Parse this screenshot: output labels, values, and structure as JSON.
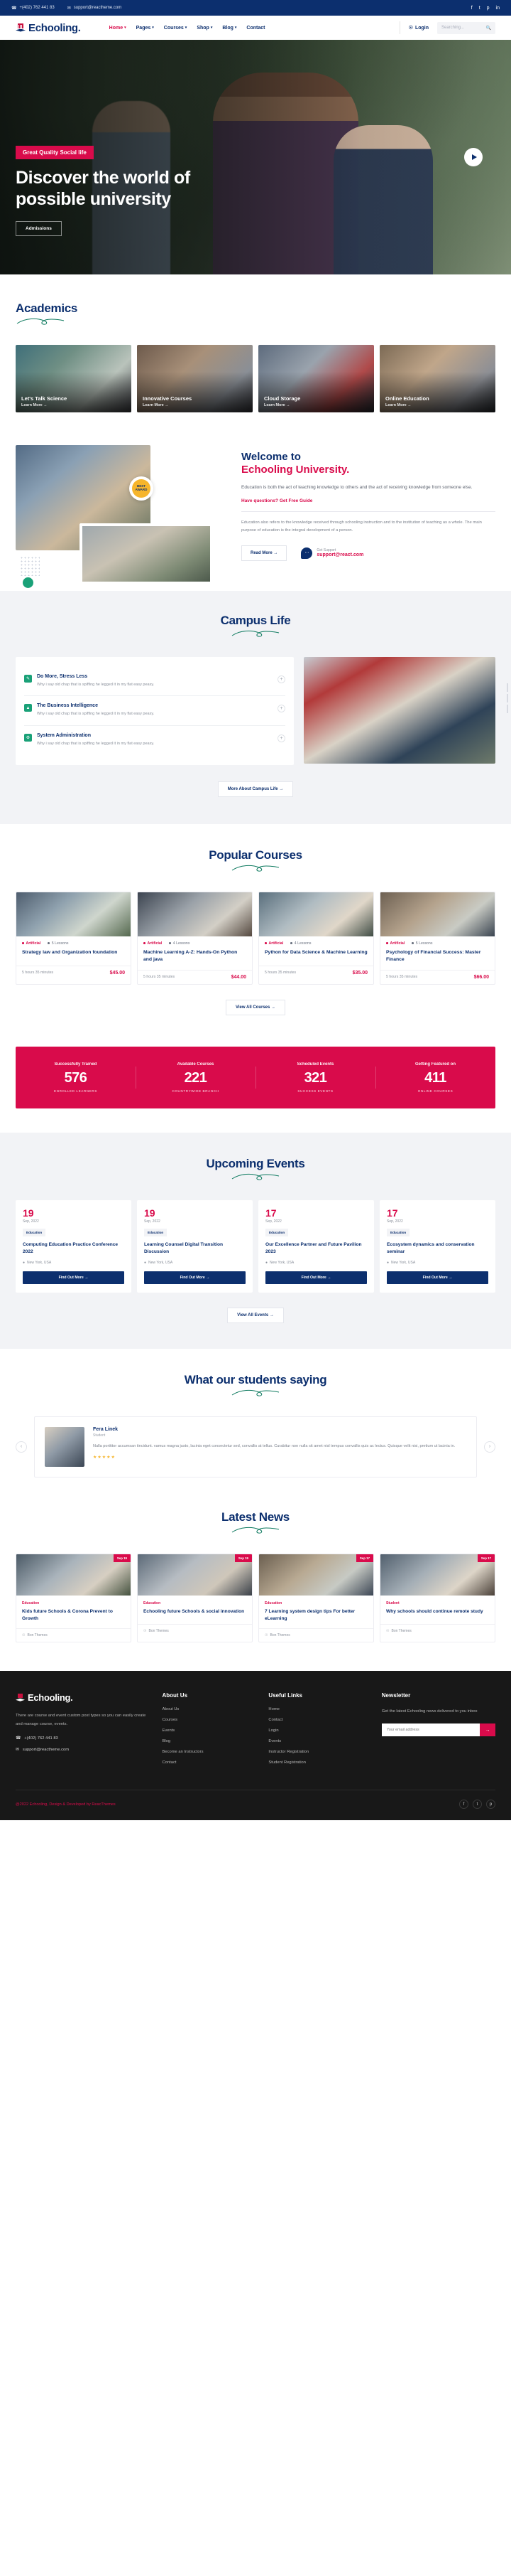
{
  "topbar": {
    "phone": "+(402) 762 441 83",
    "email": "support@reactheme.com",
    "phone_icon": "phone-icon",
    "email_icon": "envelope-icon",
    "socials": [
      "f",
      "t",
      "p",
      "in"
    ]
  },
  "header": {
    "logo_text": "Echooling.",
    "nav": [
      {
        "label": "Home",
        "caret": "▾",
        "active": true
      },
      {
        "label": "Pages",
        "caret": "▾",
        "active": false
      },
      {
        "label": "Courses",
        "caret": "▾",
        "active": false
      },
      {
        "label": "Shop",
        "caret": "▾",
        "active": false
      },
      {
        "label": "Blog",
        "caret": "▾",
        "active": false
      },
      {
        "label": "Contact",
        "caret": "",
        "active": false
      }
    ],
    "login_label": "Login",
    "search_placeholder": "Searching..."
  },
  "hero": {
    "badge": "Great Quality Social life",
    "title_line1": "Discover the world of",
    "title_line2": "possible university",
    "button": "Admissions",
    "play_label": "play-button"
  },
  "academics": {
    "title": "Academics",
    "cards": [
      {
        "title": "Let's Talk Science",
        "link": "Learn More  →"
      },
      {
        "title": "Innovative Courses",
        "link": "Learn More  →"
      },
      {
        "title": "Cloud Storage",
        "link": "Learn More  →"
      },
      {
        "title": "Online Education",
        "link": "Learn More  →"
      }
    ]
  },
  "welcome": {
    "heading_line1": "Welcome to",
    "heading_line2": "Echooling University.",
    "paragraph": "Education is both the act of teaching knowledge to others and the act of receiving knowledge from someone else.",
    "question_prefix": "Have questions?",
    "question_link": "Get Free Guide",
    "paragraph2": "Education also refers to the knowledge received through schooling instruction and to the institution of teaching as a whole. The main purpose of education is the integral development of a person.",
    "read_more": "Read More  →",
    "support_label": "Get Support",
    "support_email": "support@react.com",
    "badge_line1": "BEST",
    "badge_line2": "AWARD"
  },
  "campus": {
    "title": "Campus Life",
    "items": [
      {
        "title": "Do More, Stress Less",
        "desc": "Why i say old chap that is spiffing he legged it in my flat easy peasy.",
        "icon": "pen-icon",
        "icon_color": "#1aa178",
        "plus": "+"
      },
      {
        "title": "The Business Intelligence",
        "desc": "Why i say old chap that is spiffing he legged it in my flat easy peasy.",
        "icon": "chart-icon",
        "icon_color": "#1aa178",
        "plus": "+"
      },
      {
        "title": "System Administration",
        "desc": "Why i say old chap that is spiffing he legged it in my flat easy peasy.",
        "icon": "gear-icon",
        "icon_color": "#1aa178",
        "plus": "+"
      }
    ],
    "button": "More About Campus Life  →"
  },
  "courses": {
    "title": "Popular Courses",
    "cards": [
      {
        "cat": "Artificial",
        "lessons": "5 Lessons",
        "title": "Strategy law and Organization foundation",
        "duration": "5 hours  35 minutes",
        "price": "$45.00"
      },
      {
        "cat": "Artificial",
        "lessons": "4 Lessons",
        "title": "Machine Learning A-Z: Hands-On Python and java",
        "duration": "5 hours  35 minutes",
        "price": "$44.00"
      },
      {
        "cat": "Artificial",
        "lessons": "4 Lessons",
        "title": "Python for Data Science & Machine Learning",
        "duration": "5 hours  35 minutes",
        "price": "$35.00"
      },
      {
        "cat": "Artificial",
        "lessons": "5 Lessons",
        "title": "Psychology of Financial Success: Master Finance",
        "duration": "5 hours  35 minutes",
        "price": "$66.00"
      }
    ],
    "button": "View All Courses  →"
  },
  "counters": [
    {
      "top": "Successfully Trained",
      "num": "576",
      "sub": "ENROLLED LEARNERS"
    },
    {
      "top": "Available Courses",
      "num": "221",
      "sub": "COUNTRYWIDE BRANCH"
    },
    {
      "top": "Scheduled Events",
      "num": "321",
      "sub": "SUCCESS EVENTS"
    },
    {
      "top": "Getting Featured on",
      "num": "411",
      "sub": "ONLINE COURSES"
    }
  ],
  "events": {
    "title": "Upcoming Events",
    "cards": [
      {
        "day": "19",
        "month": "Sep, 2022",
        "cat": "Education",
        "title": "Computing Education Practice Conference 2022",
        "loc": "New York, USA",
        "btn": "Find Out More  →"
      },
      {
        "day": "19",
        "month": "Sep, 2022",
        "cat": "Education",
        "title": "Learning Counsel Digital Transition Discussion",
        "loc": "New York, USA",
        "btn": "Find Out More  →"
      },
      {
        "day": "17",
        "month": "Sep, 2022",
        "cat": "Education",
        "title": "Our Excellence Partner and Future Pavilion 2023",
        "loc": "New York, USA",
        "btn": "Find Out More  →"
      },
      {
        "day": "17",
        "month": "Sep, 2022",
        "cat": "Education",
        "title": "Ecosystem dynamics and conservation seminar",
        "loc": "New York, USA",
        "btn": "Find Out More  →"
      }
    ],
    "button": "View All Events  →"
  },
  "testimonials": {
    "title": "What our students saying",
    "name": "Fera Linek",
    "role": "Student",
    "text": "Nulla porttitor accumsan tincidunt. vamus magna justo, lacinia eget consectetur sed, convallis at tellus. Curabitur non nulla sit amet nisl tempus convallis quis ac lectus. Quisque velit nisi, pretium ut lacinia in.",
    "stars": "★★★★★",
    "prev": "‹",
    "next": "›"
  },
  "news": {
    "title": "Latest News",
    "cards": [
      {
        "tag": "Sep 19",
        "cat": "Education",
        "title": "Kids future Schools & Corona Prevent to Growth",
        "author": "Bon Themes"
      },
      {
        "tag": "Sep 19",
        "cat": "Education",
        "title": "Echooling future Schools & social innovation",
        "author": "Bon Themes"
      },
      {
        "tag": "Sep 17",
        "cat": "Education",
        "title": "7 Learning system design tips For better eLearning",
        "author": "Bon Themes"
      },
      {
        "tag": "Sep 17",
        "cat": "Student",
        "title": "Why schools should continue remote study",
        "author": "Bon Themes"
      }
    ]
  },
  "footer": {
    "logo_text": "Echooling.",
    "desc": "There are course and event custom post types so you can easily create and manage course, events.",
    "phone": "+(402) 762 441 83",
    "email": "support@reactheme.com",
    "col2_title": "About Us",
    "col2": [
      "About Us",
      "Courses",
      "Events",
      "Blog",
      "Become an Instructors",
      "Contact"
    ],
    "col3_title": "Useful Links",
    "col3": [
      "Home",
      "Contact",
      "Login",
      "Events",
      "Instructor Registration",
      "Student Registration"
    ],
    "col4_title": "Newsletter",
    "newsletter_text": "Get the latest Echooling news delivered to you inbox",
    "email_placeholder": "Your email address",
    "submit_icon": "→",
    "copyright_prefix": "@2022 Echooling, Design & Developed by ",
    "copyright_brand": "ReacThemes",
    "socials": [
      "f",
      "t",
      "p"
    ]
  }
}
